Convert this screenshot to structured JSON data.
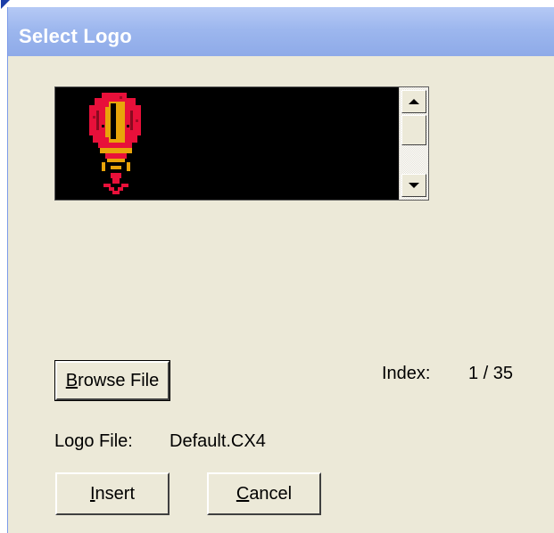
{
  "window": {
    "title": "Select Logo"
  },
  "preview": {
    "logo_name": "hot-air-balloon-logo"
  },
  "buttons": {
    "browse": {
      "mnemonic": "B",
      "rest": "rowse File"
    },
    "insert": {
      "mnemonic": "I",
      "rest": "nsert"
    },
    "cancel": {
      "mnemonic": "C",
      "rest": "ancel"
    }
  },
  "index": {
    "label": "Index:",
    "value": "1 / 35"
  },
  "logo_file": {
    "label": "Logo File:",
    "value": "Default.CX4"
  },
  "colors": {
    "title_bar": "#9db7ee",
    "dialog_bg": "#ece9d8",
    "preview_bg": "#000000",
    "logo_red": "#e8103a",
    "logo_gold": "#e8a40a"
  }
}
